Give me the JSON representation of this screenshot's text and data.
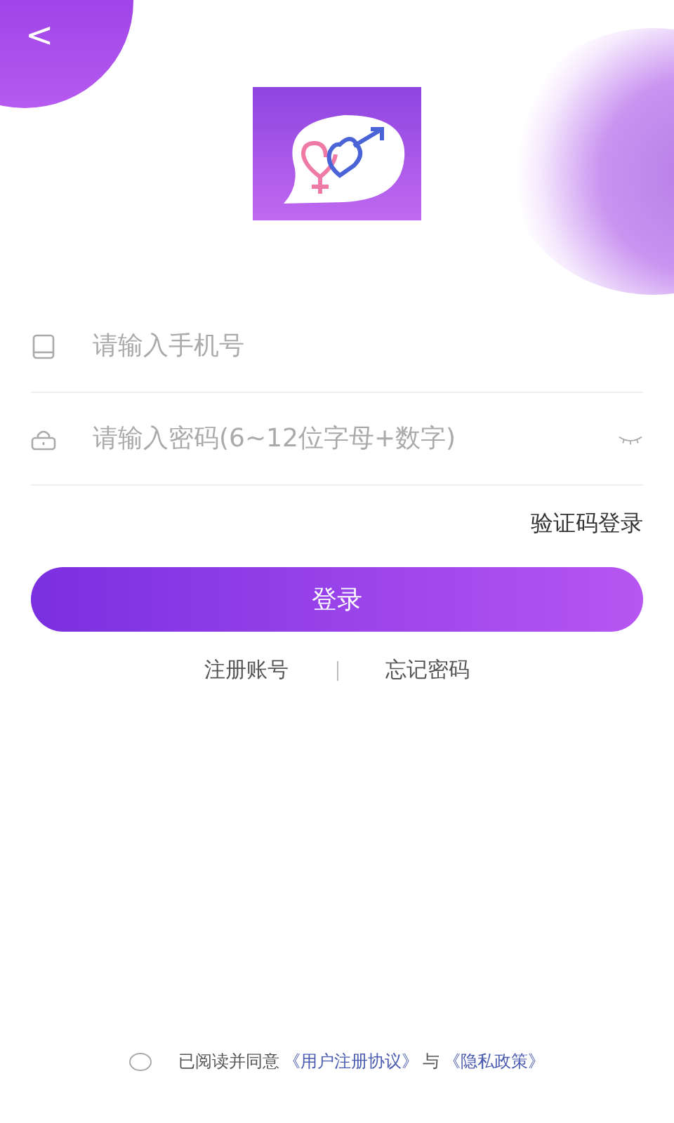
{
  "back": {
    "label": "<"
  },
  "fields": [
    {
      "kind": "phone",
      "placeholder": "请输入手机号"
    },
    {
      "kind": "password",
      "placeholder": "请输入密码(6~12位字母+数字)"
    }
  ],
  "code_login": "验证码登录",
  "login_button": "登录",
  "links": [
    "注册账号",
    "忘记密码"
  ],
  "agreement": {
    "checked": false,
    "text": "已阅读并同意",
    "terms": "《用户注册协议》",
    "joiner": "与",
    "privacy": "《隐私政策》"
  }
}
